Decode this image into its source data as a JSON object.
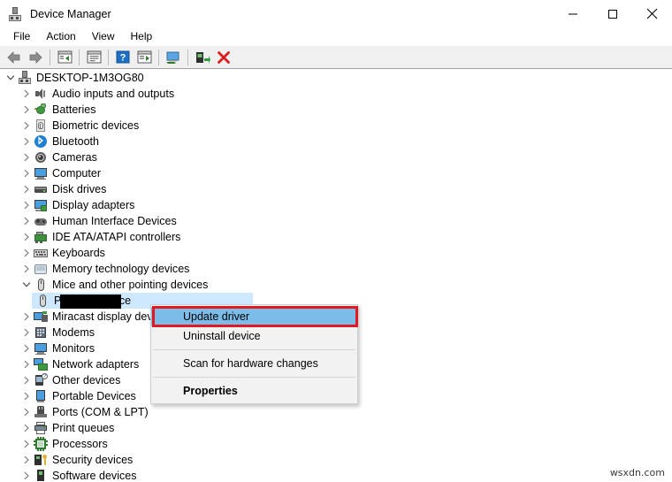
{
  "window": {
    "title": "Device Manager",
    "icon": "device-manager-icon",
    "controls": {
      "minimize": "minimize-icon",
      "maximize": "maximize-icon",
      "close": "close-icon"
    }
  },
  "menubar": {
    "items": [
      {
        "label": "File"
      },
      {
        "label": "Action"
      },
      {
        "label": "View"
      },
      {
        "label": "Help"
      }
    ]
  },
  "toolbar": {
    "buttons": [
      {
        "name": "back-button",
        "icon": "left-arrow-icon"
      },
      {
        "name": "forward-button",
        "icon": "right-arrow-icon"
      },
      {
        "name": "show-hide-console-tree-button",
        "icon": "console-tree-icon"
      },
      {
        "name": "properties-button",
        "icon": "properties-window-icon"
      },
      {
        "name": "help-button",
        "icon": "question-mark-icon"
      },
      {
        "name": "view-button",
        "icon": "view-list-icon"
      },
      {
        "name": "scan-hardware-changes-button",
        "icon": "scan-monitor-icon"
      },
      {
        "name": "update-driver-button",
        "icon": "update-driver-plug-icon"
      },
      {
        "name": "uninstall-device-button",
        "icon": "red-x-icon"
      }
    ]
  },
  "tree": {
    "root": {
      "label": "DESKTOP-1M3OG80",
      "icon": "computer-icon",
      "expanded": true
    },
    "nodes": [
      {
        "label": "Audio inputs and outputs",
        "icon": "speaker-icon",
        "expanded": false,
        "indent": 1
      },
      {
        "label": "Batteries",
        "icon": "battery-icon",
        "expanded": false,
        "indent": 1
      },
      {
        "label": "Biometric devices",
        "icon": "fingerprint-icon",
        "expanded": false,
        "indent": 1
      },
      {
        "label": "Bluetooth",
        "icon": "bluetooth-icon",
        "expanded": false,
        "indent": 1
      },
      {
        "label": "Cameras",
        "icon": "camera-icon",
        "expanded": false,
        "indent": 1
      },
      {
        "label": "Computer",
        "icon": "monitor-icon",
        "expanded": false,
        "indent": 1
      },
      {
        "label": "Disk drives",
        "icon": "disk-drive-icon",
        "expanded": false,
        "indent": 1
      },
      {
        "label": "Display adapters",
        "icon": "display-adapter-icon",
        "expanded": false,
        "indent": 1
      },
      {
        "label": "Human Interface Devices",
        "icon": "hid-gamepad-icon",
        "expanded": false,
        "indent": 1
      },
      {
        "label": "IDE ATA/ATAPI controllers",
        "icon": "ide-controller-icon",
        "expanded": false,
        "indent": 1
      },
      {
        "label": "Keyboards",
        "icon": "keyboard-icon",
        "expanded": false,
        "indent": 1
      },
      {
        "label": "Memory technology devices",
        "icon": "memory-icon",
        "expanded": false,
        "indent": 1
      },
      {
        "label": "Mice and other pointing devices",
        "icon": "mouse-icon",
        "expanded": true,
        "indent": 1
      },
      {
        "label": "Pointing Device",
        "icon": "mouse-icon",
        "expanded": false,
        "indent": 2,
        "selected": true,
        "redacted": true
      },
      {
        "label": "Miracast display devices",
        "icon": "miracast-icon",
        "expanded": false,
        "indent": 1
      },
      {
        "label": "Modems",
        "icon": "modem-icon",
        "expanded": false,
        "indent": 1
      },
      {
        "label": "Monitors",
        "icon": "monitor-icon",
        "expanded": false,
        "indent": 1
      },
      {
        "label": "Network adapters",
        "icon": "network-adapter-icon",
        "expanded": false,
        "indent": 1
      },
      {
        "label": "Other devices",
        "icon": "unknown-device-icon",
        "expanded": false,
        "indent": 1
      },
      {
        "label": "Portable Devices",
        "icon": "portable-device-icon",
        "expanded": false,
        "indent": 1
      },
      {
        "label": "Ports (COM & LPT)",
        "icon": "ports-icon",
        "expanded": false,
        "indent": 1
      },
      {
        "label": "Print queues",
        "icon": "printer-icon",
        "expanded": false,
        "indent": 1
      },
      {
        "label": "Processors",
        "icon": "processor-icon",
        "expanded": false,
        "indent": 1
      },
      {
        "label": "Security devices",
        "icon": "security-device-icon",
        "expanded": false,
        "indent": 1
      },
      {
        "label": "Software devices",
        "icon": "software-device-icon",
        "expanded": false,
        "indent": 1
      }
    ]
  },
  "context_menu": {
    "items": [
      {
        "label": "Update driver",
        "highlighted": true,
        "bold": false
      },
      {
        "label": "Uninstall device",
        "highlighted": false,
        "bold": false
      },
      {
        "separator_after": true
      },
      {
        "label": "Scan for hardware changes",
        "highlighted": false,
        "bold": false
      },
      {
        "separator_after": true
      },
      {
        "label": "Properties",
        "highlighted": false,
        "bold": true
      }
    ]
  },
  "annotation": {
    "highlight_color": "#e01a22",
    "selection_color": "#cde8ff",
    "menu_highlight_color": "#7cbce8"
  },
  "watermark": {
    "text": "wsxdn.com"
  }
}
